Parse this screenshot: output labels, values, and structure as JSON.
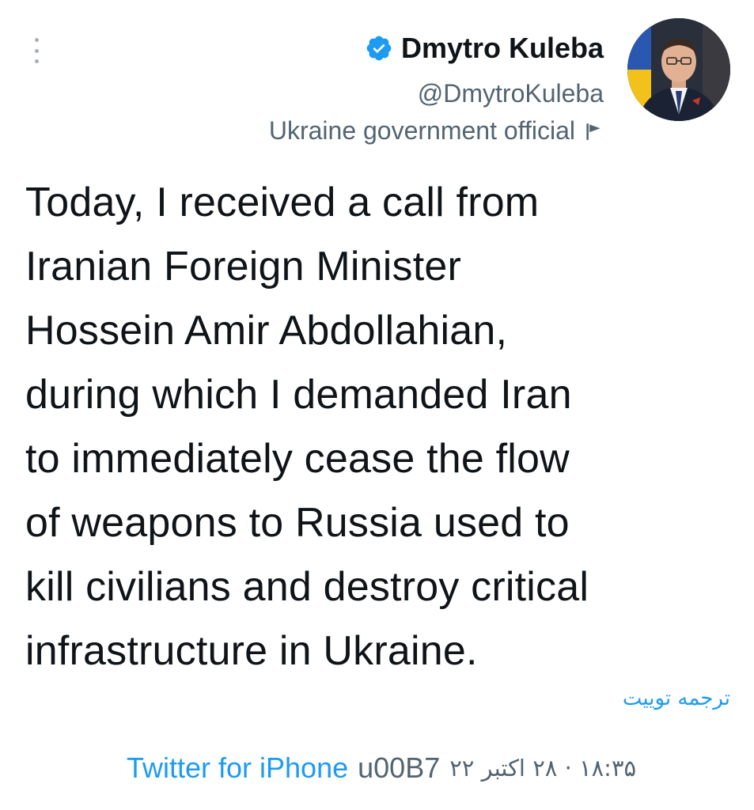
{
  "author": {
    "display_name": "Dmytro Kuleba",
    "handle": "@DmytroKuleba",
    "label": "Ukraine government official",
    "verified_icon": "verified-badge-icon",
    "label_icon": "flag-icon",
    "avatar": "avatar"
  },
  "tweet": {
    "lines": [
      "Today, I received a call from",
      "Iranian Foreign Minister",
      "Hossein Amir Abdollahian,",
      "during which I demanded Iran",
      "to immediately cease the flow",
      "of weapons to Russia used to",
      "kill civilians and destroy critical",
      "infrastructure in Ukraine."
    ],
    "translate_label": "ترجمه توییت"
  },
  "meta": {
    "source": "Twitter for iPhone",
    "separator_code": "u00B7",
    "date_time": "۱۸:۳۵ · ۲۸ اکتبر ۲۲"
  },
  "colors": {
    "accent": "#1d9bf0",
    "text": "#0f1419",
    "secondary": "#536471",
    "menu_dots": "#a7b0b8"
  }
}
